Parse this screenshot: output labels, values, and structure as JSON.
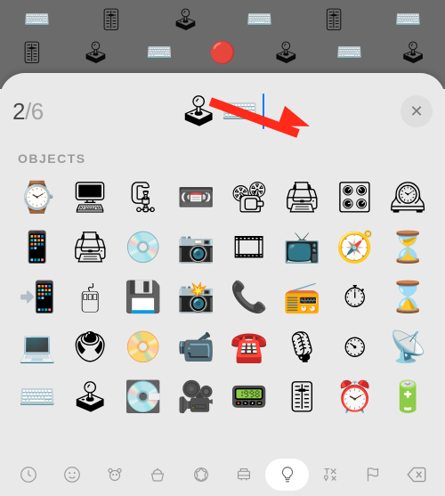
{
  "counter": {
    "current": "2",
    "separator": "/",
    "total": "6"
  },
  "selected": [
    "🕹",
    "⌨️"
  ],
  "section_label": "OBJECTS",
  "close_glyph": "✕",
  "bg_row1": [
    "⌨️",
    "🎚",
    "🕹",
    "⌨️",
    "🎚",
    "⌨️"
  ],
  "bg_row2": [
    "🎚",
    "🕹",
    "⌨️",
    "🔴",
    "🕹",
    "⌨️",
    "🕹"
  ],
  "grid": [
    [
      "⌚",
      "🖥",
      "🗜",
      "📼",
      "📽",
      "🖨",
      "🎛",
      "🕰"
    ],
    [
      "📱",
      "🖨",
      "💿",
      "📷",
      "🎞",
      "📺",
      "🧭",
      "⏳"
    ],
    [
      "📲",
      "🖱",
      "💾",
      "📸",
      "📞",
      "📻",
      "⏱",
      "⌛"
    ],
    [
      "💻",
      "🖲",
      "📀",
      "📹",
      "☎️",
      "🎙",
      "⏲",
      "📡"
    ],
    [
      "⌨️",
      "🕹",
      "💽",
      "🎥",
      "📟",
      "🎚",
      "⏰",
      "🔋"
    ]
  ],
  "categories": [
    {
      "name": "recents",
      "active": false
    },
    {
      "name": "smileys",
      "active": false
    },
    {
      "name": "animals",
      "active": false
    },
    {
      "name": "food",
      "active": false
    },
    {
      "name": "activity",
      "active": false
    },
    {
      "name": "travel",
      "active": false
    },
    {
      "name": "objects",
      "active": true
    },
    {
      "name": "symbols",
      "active": false
    },
    {
      "name": "flags",
      "active": false
    }
  ]
}
